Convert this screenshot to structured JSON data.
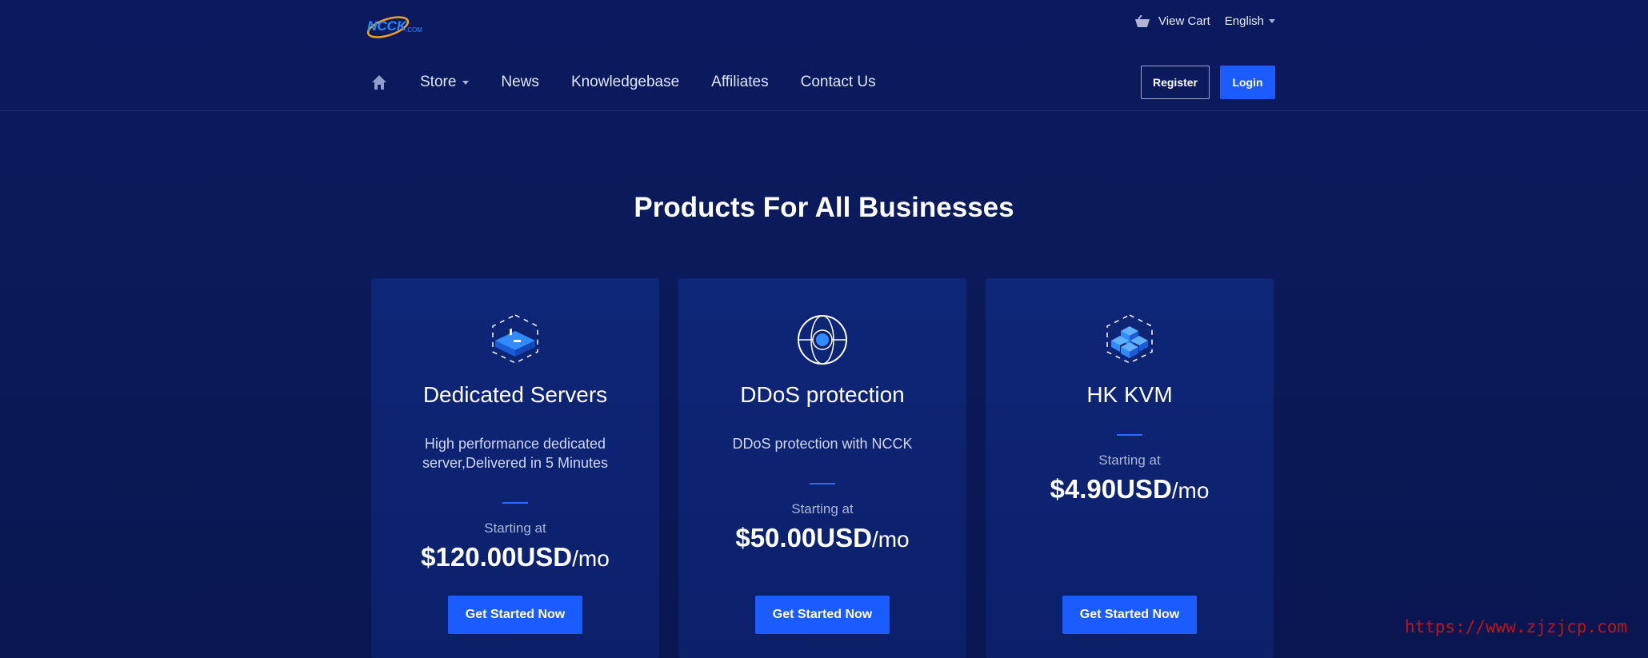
{
  "topbar": {
    "logo_text": "NCCK",
    "logo_sub": ".COM",
    "cart_label": "View Cart",
    "language_label": "English"
  },
  "nav": {
    "items": [
      {
        "label": "Store",
        "icon": "caret-down-icon"
      },
      {
        "label": "News"
      },
      {
        "label": "Knowledgebase"
      },
      {
        "label": "Affiliates"
      },
      {
        "label": "Contact Us"
      }
    ],
    "register_label": "Register",
    "login_label": "Login"
  },
  "hero": {
    "title": "Products For All Businesses"
  },
  "cards": [
    {
      "icon": "dedicated-server-icon",
      "title": "Dedicated Servers",
      "desc_line1": "High performance dedicated",
      "desc_line2": "server,Delivered in 5 Minutes",
      "starting_label": "Starting at",
      "price": "$120.00USD",
      "period": "/mo",
      "button_label": "Get Started Now"
    },
    {
      "icon": "globe-shield-icon",
      "title": "DDoS protection",
      "desc_line1": "DDoS protection with NCCK",
      "desc_line2": "",
      "starting_label": "Starting at",
      "price": "$50.00USD",
      "period": "/mo",
      "button_label": "Get Started Now"
    },
    {
      "icon": "cubes-icon",
      "title": "HK KVM",
      "desc_line1": "",
      "desc_line2": "",
      "starting_label": "Starting at",
      "price": "$4.90USD",
      "period": "/mo",
      "button_label": "Get Started Now"
    }
  ],
  "watermark": "https://www.zjzjcp.com",
  "colors": {
    "accent": "#1a5cff",
    "background": "#0a1a5a",
    "card": "#0e2678"
  }
}
